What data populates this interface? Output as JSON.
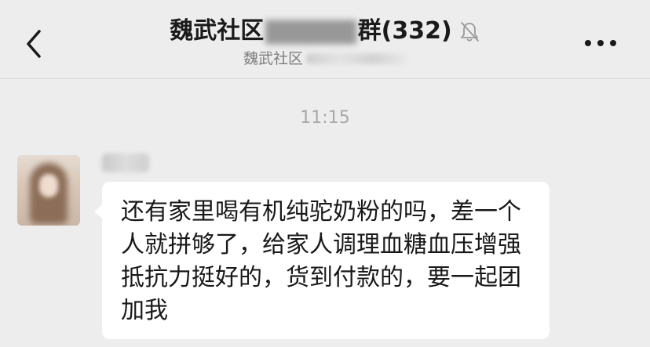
{
  "header": {
    "title_prefix": "魏武社区",
    "title_blurred": "▇▇▇▇▇",
    "title_suffix": "群",
    "member_count": "(332)",
    "subtitle_prefix": "魏武社区",
    "icons": {
      "back": "chevron-left-icon",
      "mute": "bell-off-icon",
      "more": "more-horizontal-icon"
    }
  },
  "chat": {
    "timestamp": "11:15",
    "messages": [
      {
        "sender_blurred": "▇▇",
        "text": "还有家里喝有机纯驼奶粉的吗，差一个人就拼够了，给家人调理血糖血压增强抵抗力挺好的，货到付款的，要一起团加我"
      }
    ]
  },
  "colors": {
    "background": "#ededed",
    "bubble": "#ffffff",
    "text": "#191919",
    "muted": "#a8a8a8"
  }
}
